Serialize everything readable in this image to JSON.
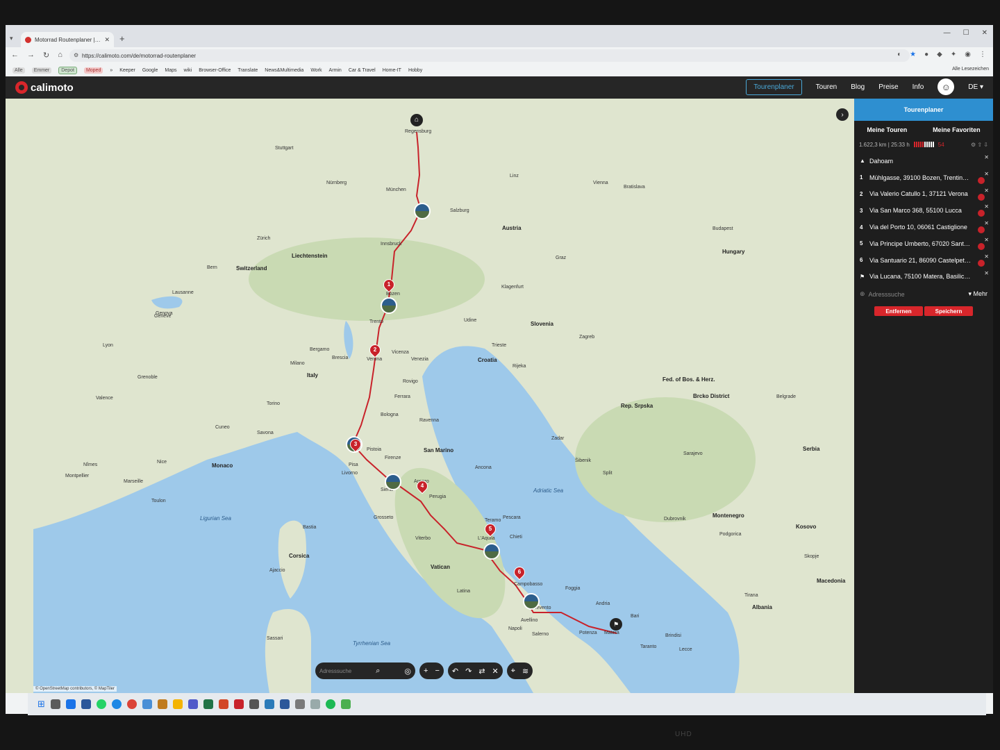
{
  "browser": {
    "tab_title": "Motorrad Routenplaner | calim",
    "url": "https://calimoto.com/de/motorrad-routenplaner",
    "bookmarks": [
      {
        "label": "Alle",
        "style": "pill"
      },
      {
        "label": "Emmer",
        "style": "pill"
      },
      {
        "label": "Depot",
        "style": "green"
      },
      {
        "label": "Moped",
        "style": "red"
      },
      {
        "label": "»",
        "style": "plain"
      },
      {
        "label": "Keeper",
        "style": "plain"
      },
      {
        "label": "Google",
        "style": "plain"
      },
      {
        "label": "Maps",
        "style": "plain"
      },
      {
        "label": "wiki",
        "style": "plain"
      },
      {
        "label": "Browser-Office",
        "style": "plain"
      },
      {
        "label": "Translate",
        "style": "plain"
      },
      {
        "label": "News&Multimedia",
        "style": "plain"
      },
      {
        "label": "Work",
        "style": "plain"
      },
      {
        "label": "Armin",
        "style": "plain"
      },
      {
        "label": "Car & Travel",
        "style": "plain"
      },
      {
        "label": "Home-IT",
        "style": "plain"
      },
      {
        "label": "Hobby",
        "style": "plain"
      }
    ],
    "all_bookmarks": "Alle Lesezeichen"
  },
  "app": {
    "logo": "calimoto",
    "nav": [
      "Tourenplaner",
      "Touren",
      "Blog",
      "Preise",
      "Info"
    ],
    "language": "DE"
  },
  "map": {
    "countries": [
      "Austria",
      "Switzerland",
      "Italy",
      "Slovenia",
      "Croatia",
      "Hungary",
      "Serbia",
      "Montenegro",
      "Albania",
      "Macedonia",
      "Kosovo",
      "San Marino",
      "Vatican",
      "Monaco",
      "Liechtenstein",
      "Corsica",
      "Fed. of Bos. & Herz.",
      "Rep. Srpska",
      "Brcko District"
    ],
    "cities": [
      "Regensburg",
      "München",
      "Salzburg",
      "Innsbruck",
      "Bozen",
      "Trento",
      "Verona",
      "Vicenza",
      "Venezia",
      "Rovigo",
      "Ferrara",
      "Bologna",
      "Ravenna",
      "Pistoia",
      "Firenze",
      "Pisa",
      "Livorno",
      "Arezzo",
      "Perugia",
      "Siena",
      "Grosseto",
      "Viterbo",
      "Teramo",
      "L'Aquila",
      "Chieti",
      "Campobasso",
      "Foggia",
      "Benevento",
      "Avellino",
      "Napoli",
      "Salerno",
      "Potenza",
      "Matera",
      "Andria",
      "Bari",
      "Brindisi",
      "Lecce",
      "Taranto",
      "Vienna",
      "Bratislava",
      "Budapest",
      "Zagreb",
      "Rijeka",
      "Trieste",
      "Udine",
      "Split",
      "Sarajevo",
      "Belgrade",
      "Podgorica",
      "Tirana",
      "Skopje",
      "Milano",
      "Bergamo",
      "Brescia",
      "Torino",
      "Genova",
      "Bern",
      "Zürich",
      "Lausanne",
      "Genève",
      "Nice",
      "Savona",
      "Cuneo",
      "Grenoble",
      "Lyon",
      "Valence",
      "Nîmes",
      "Montpellier",
      "Marseille",
      "Toulon",
      "Stuttgart",
      "Nürnberg",
      "Linz",
      "Graz",
      "Klagenfurt",
      "Ancona",
      "Pescara",
      "Latina",
      "Bastia",
      "Ajaccio",
      "Sassari",
      "Dubrovnik",
      "Zadar",
      "Šibenik"
    ],
    "seas": [
      "Adriatic Sea",
      "Tyrrhenian Sea",
      "Ligurian Sea"
    ],
    "attribution": "© OpenStreetMap contributors, © MapTiler",
    "waypoint_numbers": [
      "1",
      "2",
      "3",
      "4",
      "5",
      "6"
    ],
    "search_placeholder": "Adresssuche"
  },
  "panel": {
    "title": "Tourenplaner",
    "tabs": [
      "Meine Touren",
      "Meine Favoriten"
    ],
    "stats": "1.622,3 km | 25:33 h",
    "curve_score": "54",
    "start": {
      "label": "Dahoam"
    },
    "waypoints": [
      {
        "idx": "1",
        "address": "Mühlgasse, 39100 Bozen, Trentino-Südtirol"
      },
      {
        "idx": "2",
        "address": "Via Valerio Catullo 1, 37121 Verona"
      },
      {
        "idx": "3",
        "address": "Via San Marco 368, 55100 Lucca"
      },
      {
        "idx": "4",
        "address": "Via del Porto 10, 06061 Castiglione"
      },
      {
        "idx": "5",
        "address": "Via Principe Umberto, 67020 Santo Stefano"
      },
      {
        "idx": "6",
        "address": "Via Santuario 21, 86090 Castelpetroso"
      }
    ],
    "end": {
      "label": "Via Lucana, 75100 Matera, Basilicata"
    },
    "address_search": "Adresssuche",
    "more": "Mehr",
    "remove": "Entfernen",
    "save": "Speichern"
  },
  "monitor_label": "UHD"
}
